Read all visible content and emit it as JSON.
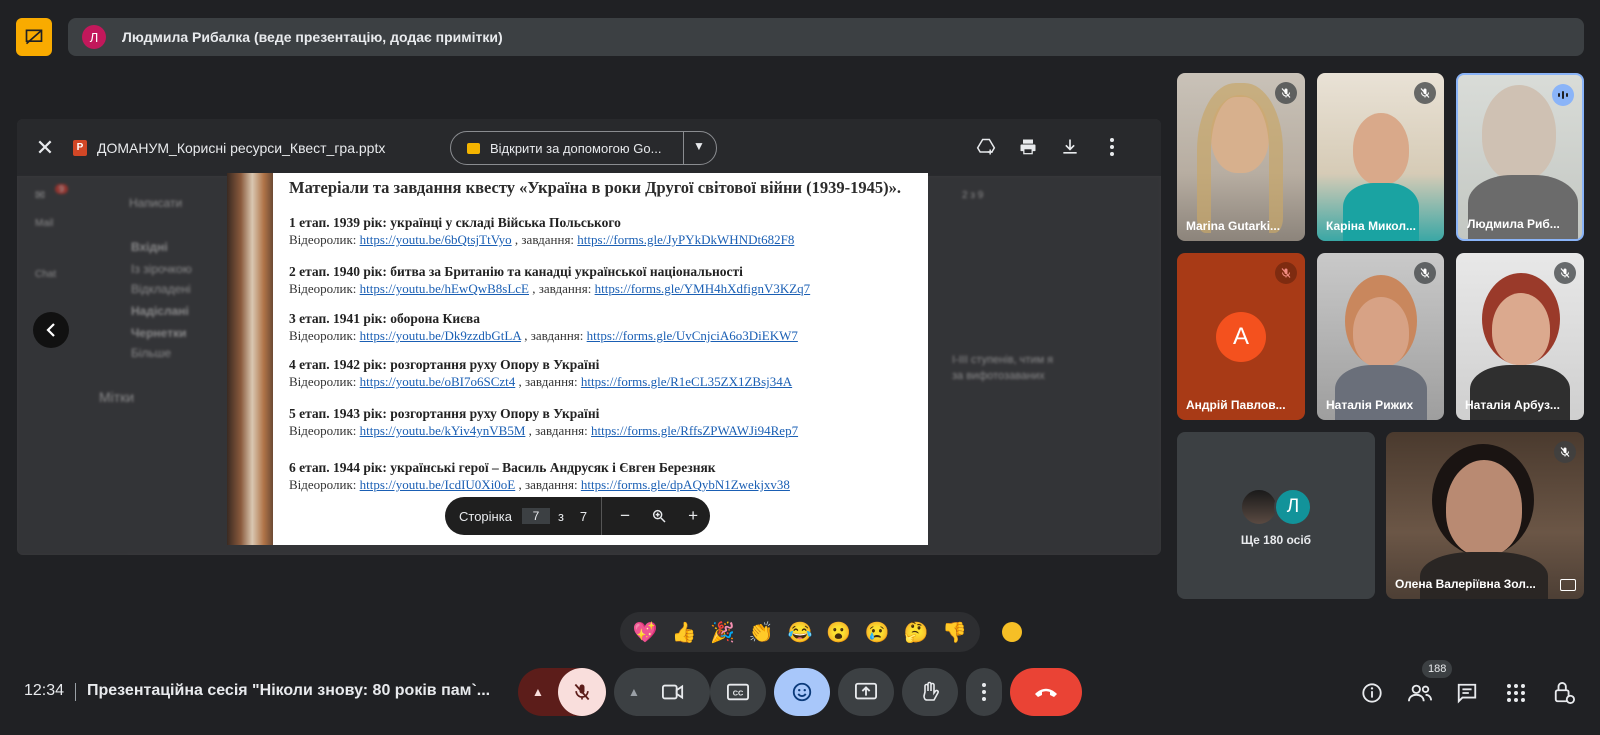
{
  "presenter": {
    "avatar_letter": "Л",
    "text": "Людмила Рибалка (веде презентацію, додає примітки)"
  },
  "viewer": {
    "file_name": "ДОМАНУМ_Корисні ресурси_Квест_гра.pptx",
    "open_with_label": "Відкрити за допомогою Go..."
  },
  "background_gmail": {
    "compose": "Написати",
    "app": "Mail",
    "chat": "Chat",
    "badge": "9",
    "inbox": "Вхідні",
    "starred": "Із зірочкою",
    "snoozed": "Відкладені",
    "sent": "Надіслані",
    "drafts": "Чернетки",
    "more": "Більше",
    "labels": "Мітки",
    "pager": "2 з 9",
    "snippet1": "I-III ступенів, чтим я",
    "snippet2": "за вифотозаваних"
  },
  "slide": {
    "title": "Матеріали та завдання квесту «Україна в роки Другої світової війни (1939-1945)».",
    "video_label": "Відеоролик:",
    "task_label": ", завдання:",
    "stages": [
      {
        "title": "1 етап. 1939 рік: українці у складі Війська Польського",
        "video": "https://youtu.be/6bQtsjTtVyo",
        "task": "https://forms.gle/JyPYkDkWHNDt682F8"
      },
      {
        "title": "2 етап. 1940 рік: битва за Британію та канадці української національності",
        "video": "https://youtu.be/hEwQwB8sLcE",
        "task": "https://forms.gle/YMH4hXdfignV3KZq7"
      },
      {
        "title": "3 етап. 1941 рік: оборона Києва",
        "video": "https://youtu.be/Dk9zzdbGtLA",
        "task": "https://forms.gle/UvCnjciA6o3DiEKW7"
      },
      {
        "title": "4 етап. 1942 рік: розгортання руху Опору в Україні",
        "video": "https://youtu.be/oBI7o6SCzt4",
        "task": "https://forms.gle/R1eCL35ZX1ZBsj34A"
      },
      {
        "title": "5 етап. 1943 рік: розгортання руху Опору в Україні",
        "video": "https://youtu.be/kYiv4ynVB5M",
        "task": "https://forms.gle/RffsZPWAWJi94Rep7"
      },
      {
        "title": "6 етап. 1944 рік: українські герої – Василь Андрусяк і Євген Березняк",
        "video": "https://youtu.be/IcdIU0Xi0oE",
        "task": "https://forms.gle/dpAQybN1Zwekjxv38"
      }
    ]
  },
  "page_control": {
    "label": "Сторінка",
    "current": "7",
    "of": "з",
    "total": "7"
  },
  "participants": [
    {
      "name": "Marina Gutarki...",
      "mic": "off"
    },
    {
      "name": "Каріна Микол...",
      "mic": "off"
    },
    {
      "name": "Людмила Риб...",
      "mic": "speaking"
    },
    {
      "name": "Андрій Павлов...",
      "mic": "off",
      "avatar_letter": "А"
    },
    {
      "name": "Наталія Рижих",
      "mic": "off"
    },
    {
      "name": "Наталія Арбуз...",
      "mic": "off"
    },
    {
      "name": "Олена Валеріївна Зол...",
      "mic": "off"
    }
  ],
  "others": {
    "avatar_letter": "Л",
    "label": "Ще 180 осіб"
  },
  "reactions": [
    "💖",
    "👍",
    "🎉",
    "👏",
    "😂",
    "😮",
    "😢",
    "🤔",
    "👎"
  ],
  "bottom": {
    "time": "12:34",
    "meeting_title": "Презентаційна сесія \"Ніколи знову: 80 років пам`...",
    "people_count": "188"
  },
  "colors": {
    "background": "#202124",
    "end_call": "#ea4335",
    "mic_off": "#f9dedc",
    "active_control": "#8ab4f8",
    "accent_yellow": "#f9ab00"
  }
}
